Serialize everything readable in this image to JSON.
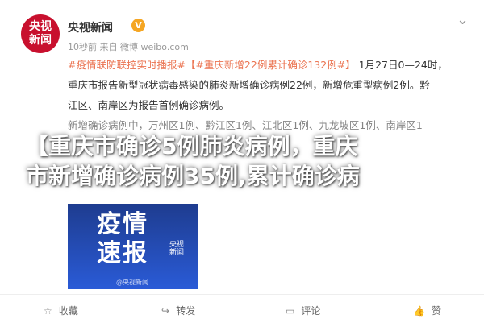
{
  "post": {
    "avatar_text_1": "央视",
    "avatar_text_2": "新闻",
    "username": "央视新闻",
    "verified": "V",
    "meta": "10秒前 来自 微博 weibo.com",
    "close": "⌄",
    "tag1": "#疫情联防联控实时播报#",
    "tag2": "【#重庆新增22例累计确诊132例#】",
    "line1_tail": "1月27日0—24时，",
    "line2": "重庆市报告新型冠状病毒感染的肺炎新增确诊病例22例，新增危重型病例2例。黔",
    "line3": "江区、南岸区为报告首例确诊病例。",
    "line4": "新增确诊病例中，万州区1例、黔江区1例、江北区1例、九龙坡区1例、南岸区1"
  },
  "headline": {
    "line1": "【重庆市确诊5例肺炎病例，重庆",
    "line2": "市新增确诊病例35例,累计确诊病"
  },
  "thumbnail": {
    "title_1": "疫情",
    "title_2": "速报",
    "logo_1": "央视",
    "logo_2": "新闻",
    "watermark": "@央视新闻"
  },
  "actions": {
    "collect": {
      "label": "收藏",
      "icon": "star-icon"
    },
    "share": {
      "label": "转发",
      "icon": "share-icon"
    },
    "comment": {
      "label": "评论",
      "icon": "comment-icon"
    },
    "like": {
      "label": "赞",
      "icon": "thumbs-up-icon"
    }
  }
}
